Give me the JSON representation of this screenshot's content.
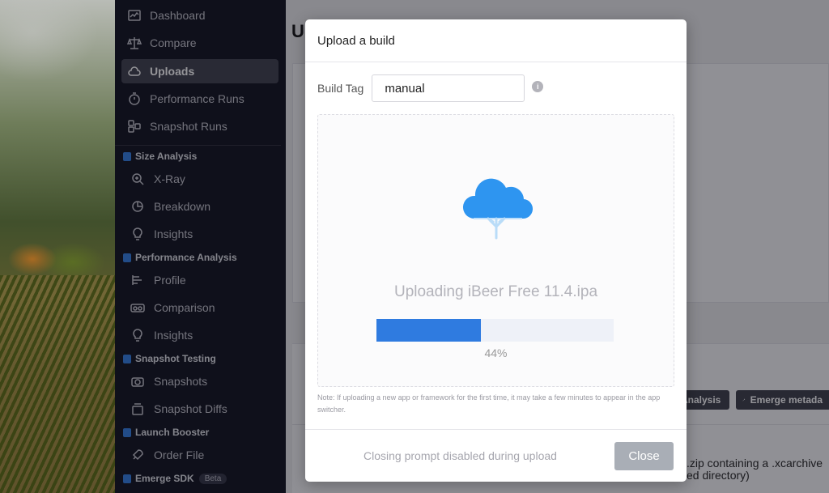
{
  "sidebar": {
    "items": [
      {
        "label": "Dashboard",
        "icon": "dashboard-icon"
      },
      {
        "label": "Compare",
        "icon": "scale-icon"
      },
      {
        "label": "Uploads",
        "icon": "cloud-icon",
        "active": true
      },
      {
        "label": "Performance Runs",
        "icon": "stopwatch-icon"
      },
      {
        "label": "Snapshot Runs",
        "icon": "snapshot-runs-icon"
      }
    ],
    "sections": [
      {
        "title": "Size Analysis",
        "items": [
          {
            "label": "X-Ray",
            "icon": "magnify-icon"
          },
          {
            "label": "Breakdown",
            "icon": "pie-icon"
          },
          {
            "label": "Insights",
            "icon": "lightbulb-icon"
          }
        ]
      },
      {
        "title": "Performance Analysis",
        "items": [
          {
            "label": "Profile",
            "icon": "profile-bars-icon"
          },
          {
            "label": "Comparison",
            "icon": "comparison-icon"
          },
          {
            "label": "Insights",
            "icon": "lightbulb-icon"
          }
        ]
      },
      {
        "title": "Snapshot Testing",
        "items": [
          {
            "label": "Snapshots",
            "icon": "camera-icon"
          },
          {
            "label": "Snapshot Diffs",
            "icon": "stack-icon"
          }
        ]
      },
      {
        "title": "Launch Booster",
        "items": [
          {
            "label": "Order File",
            "icon": "rocket-icon"
          }
        ]
      },
      {
        "title": "Emerge SDK",
        "badge": "Beta",
        "items": []
      }
    ]
  },
  "main": {
    "title_partial": "U",
    "chips": [
      "Analysis",
      "Emerge metada"
    ],
    "under_text": [
      ".zip containing a .xcarchive",
      "ed directory)"
    ]
  },
  "modal": {
    "title": "Upload a build",
    "build_tag_label": "Build Tag",
    "build_tag_value": "manual",
    "info_glyph": "i",
    "upload_text": "Uploading iBeer Free 11.4.ipa",
    "progress": 0.44,
    "progress_text": "44%",
    "note": "Note: If uploading a new app or framework for the first time, it may take a few minutes to appear in the app switcher.",
    "footer_message": "Closing prompt disabled during upload",
    "close_label": "Close"
  },
  "colors": {
    "accent": "#2f7be0",
    "sidebar_bg": "#0c0d1a",
    "progress_track": "#eef1f8",
    "close_disabled": "#a9aeb6"
  }
}
